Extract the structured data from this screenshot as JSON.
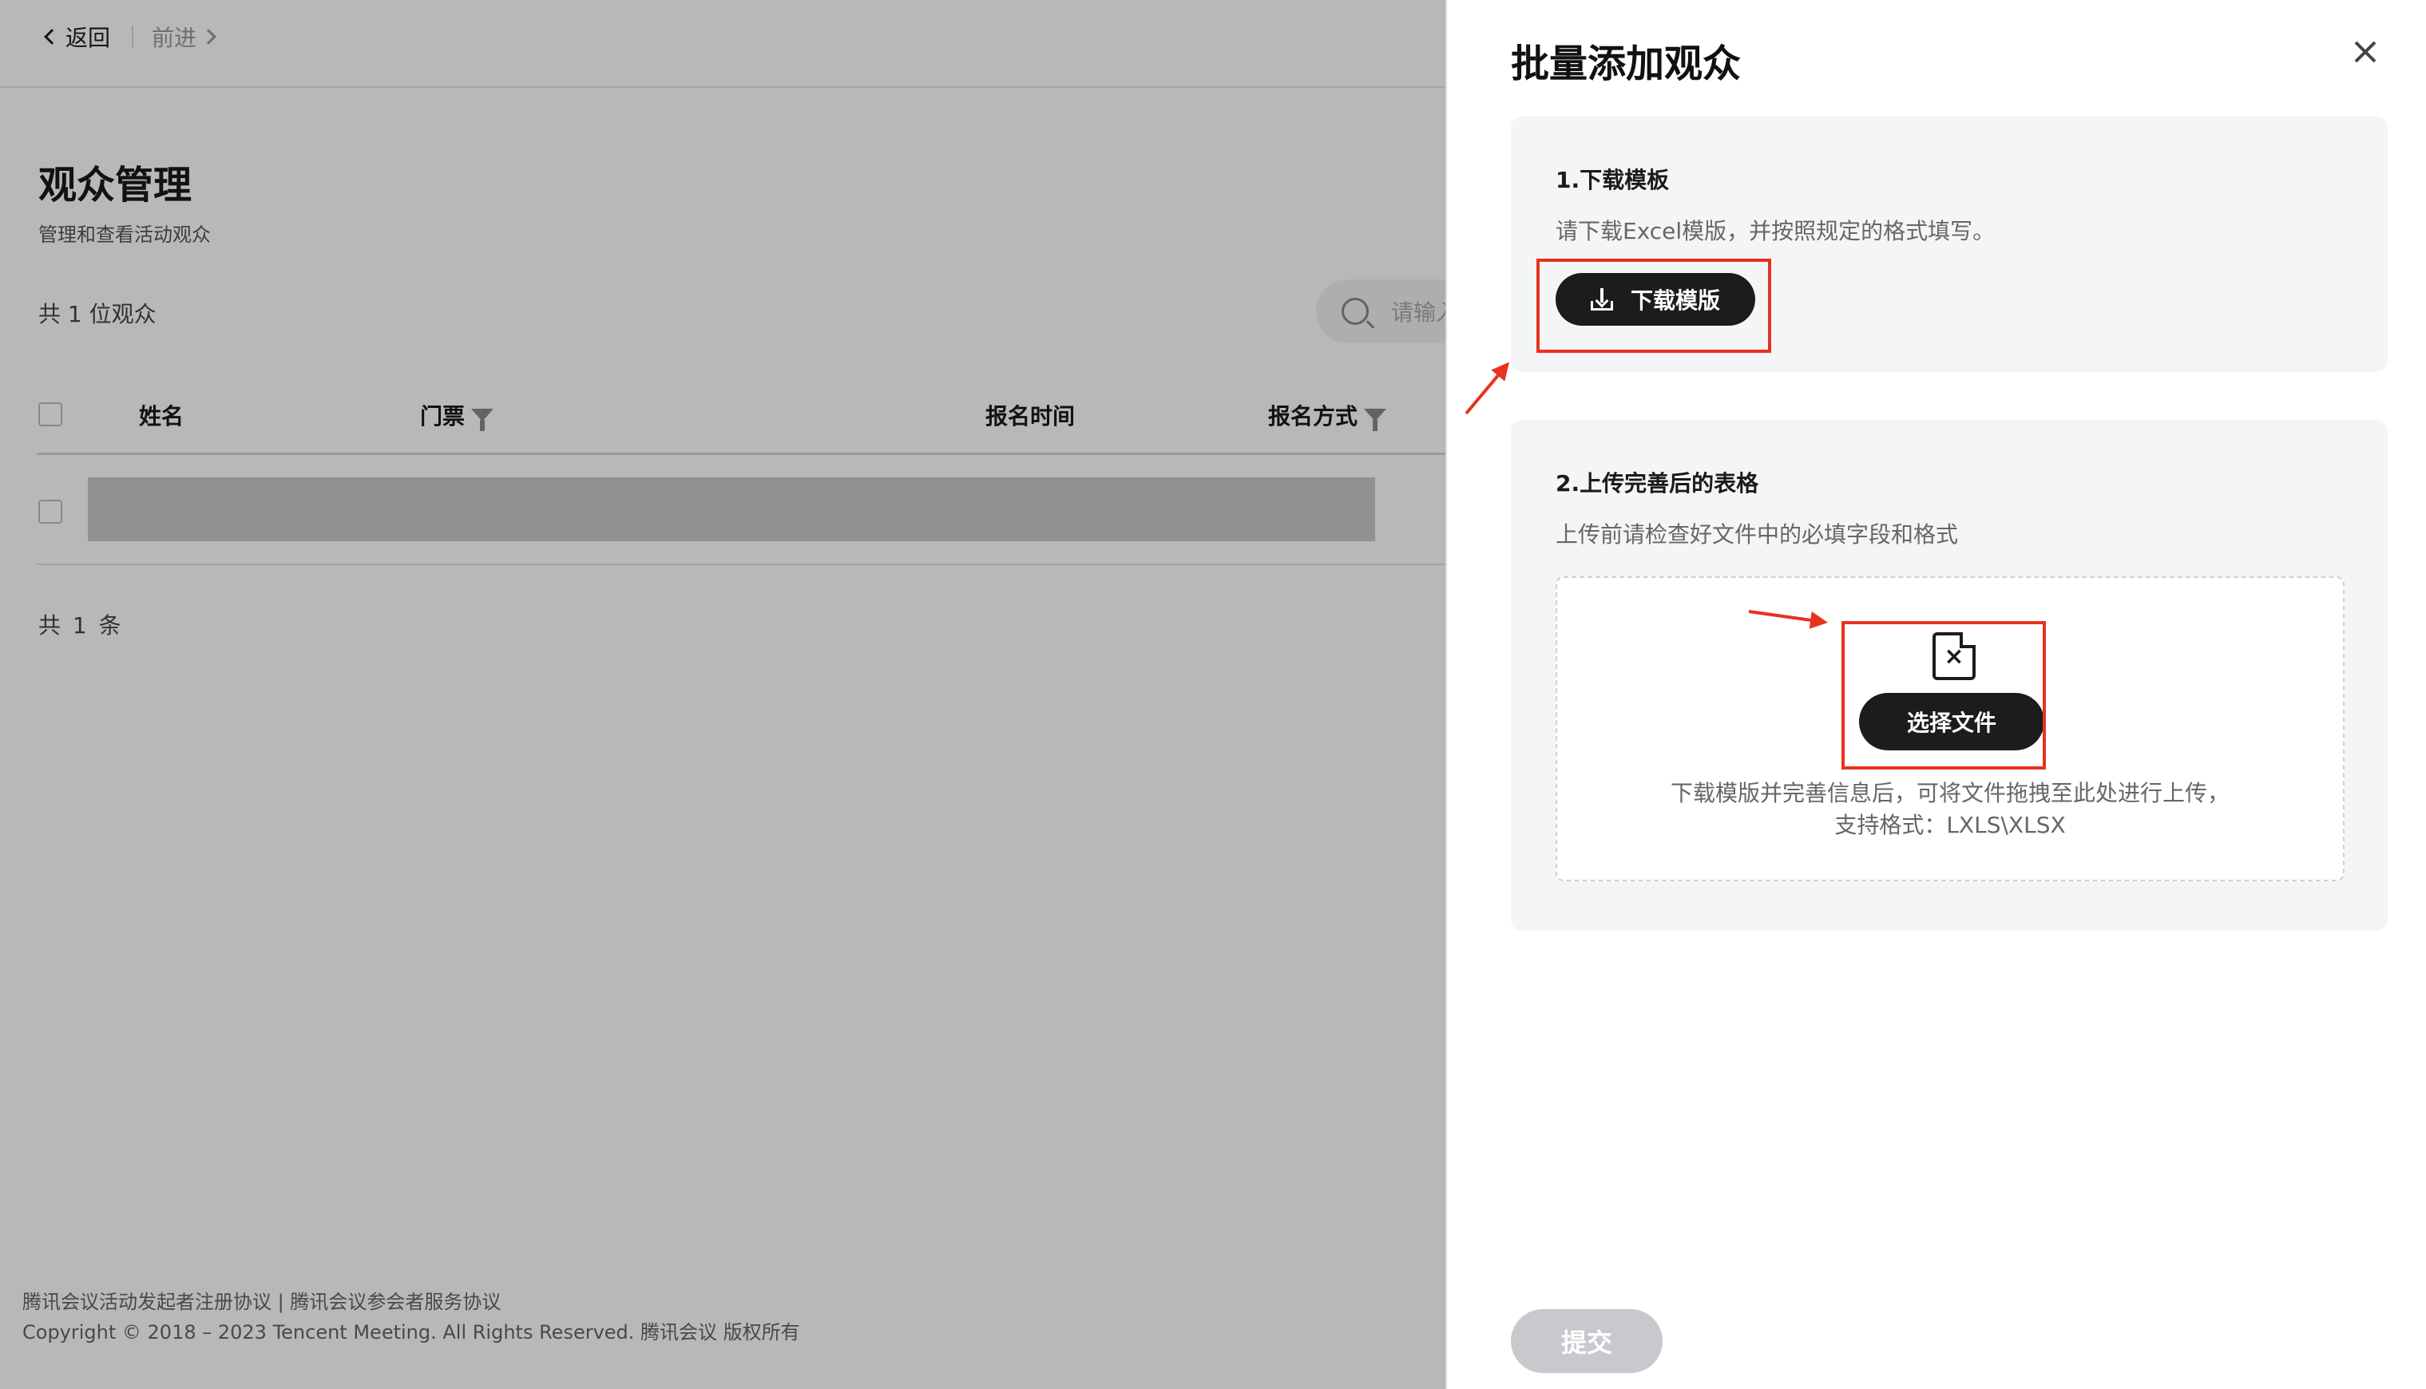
{
  "nav": {
    "back_label": "返回",
    "forward_label": "前进"
  },
  "page": {
    "title": "观众管理",
    "subtitle": "管理和查看活动观众",
    "audience_count": "共 1 位观众",
    "search_placeholder": "请输入"
  },
  "table": {
    "columns": [
      "姓名",
      "门票",
      "报名时间",
      "报名方式"
    ],
    "rows": 1,
    "total": "共 1 条"
  },
  "footer": {
    "links": "腾讯会议活动发起者注册协议 | 腾讯会议参会者服务协议",
    "copyright": "Copyright © 2018 – 2023 Tencent Meeting. All Rights Reserved. 腾讯会议 版权所有"
  },
  "drawer": {
    "title": "批量添加观众",
    "step1": {
      "title": "1.下载模板",
      "desc": "请下载Excel模版，并按照规定的格式填写。",
      "button_label": "下载模版"
    },
    "step2": {
      "title": "2.上传完善后的表格",
      "desc": "上传前请检查好文件中的必填字段和格式",
      "button_label": "选择文件",
      "hint_line1": "下载模版并完善信息后，可将文件拖拽至此处进行上传，",
      "hint_line2": "支持格式：LXLS\\XLSX"
    },
    "submit_label": "提交"
  },
  "colors": {
    "accent_dark": "#1c1c1e",
    "annotation_red": "#e8321e",
    "submit_disabled": "#c9c9cd"
  },
  "icons": [
    "chevron-left-icon",
    "chevron-right-icon",
    "search-icon",
    "filter-icon",
    "close-icon",
    "download-icon",
    "excel-file-icon"
  ]
}
